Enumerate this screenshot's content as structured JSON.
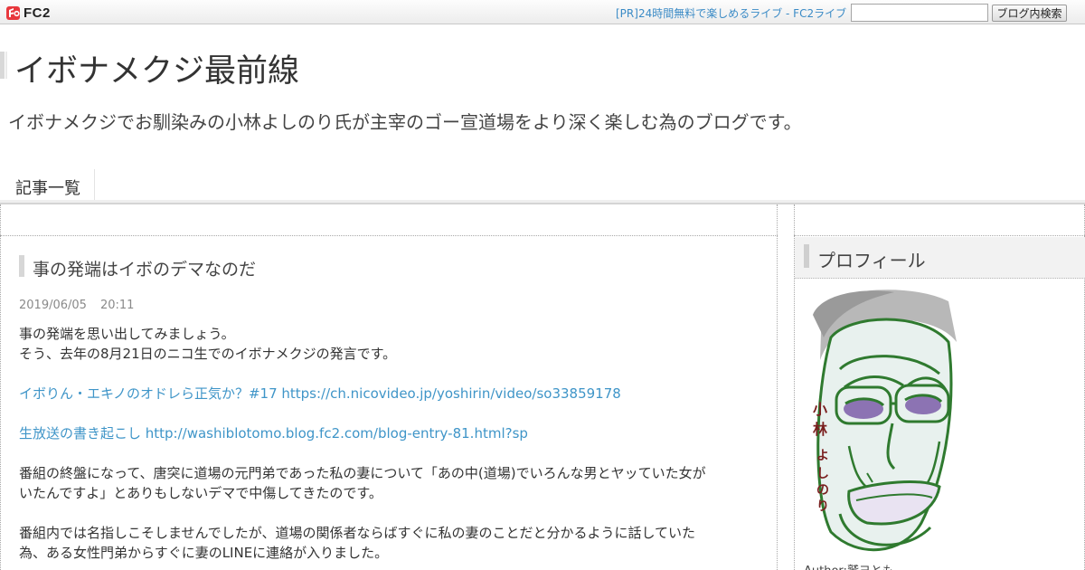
{
  "topbar": {
    "logo_text": "FC2",
    "pr_link": "[PR]24時間無料で楽しめるライブ - FC2ライブ",
    "search_value": "",
    "search_button": "ブログ内検索"
  },
  "header": {
    "title": "イボナメクジ最前線",
    "description": "イボナメクジでお馴染みの小林よしのり氏が主宰のゴー宣道場をより深く楽しむ為のブログです。"
  },
  "nav": {
    "items": [
      {
        "label": "記事一覧"
      }
    ]
  },
  "entry": {
    "title": "事の発端はイボのデマなのだ",
    "date": "2019/06/05",
    "time": "20:11",
    "lines": [
      "事の発端を思い出してみましょう。",
      "そう、去年の8月21日のニコ生でのイボナメクジの発言です。"
    ],
    "link1": "イボりん・エキノのオドレら正気か？#17 https://ch.nicovideo.jp/yoshirin/video/so33859178",
    "link2": "生放送の書き起こし http://washiblotomo.blog.fc2.com/blog-entry-81.html?sp",
    "para1_line1": "番組の終盤になって、唐突に道場の元門弟であった私の妻について「あの中(道場)でいろんな男とヤッていた女が",
    "para1_line2": "いたんですよ」とありもしないデマで中傷してきたのです。",
    "para2_line1": "番組内では名指しこそしませんでしたが、道場の関係者ならばすぐに私の妻のことだと分かるように話していた",
    "para2_line2": "為、ある女性門弟からすぐに妻のLINEに連絡が入りました。"
  },
  "sidebar": {
    "profile_title": "プロフィール",
    "avatar_caption": "小林よしのり",
    "author_line": "Author:鷲ヨとも"
  },
  "colors": {
    "link": "#3f95c8",
    "pr_link": "#3b8bc6",
    "heading_accent": "#d7d7d7"
  }
}
